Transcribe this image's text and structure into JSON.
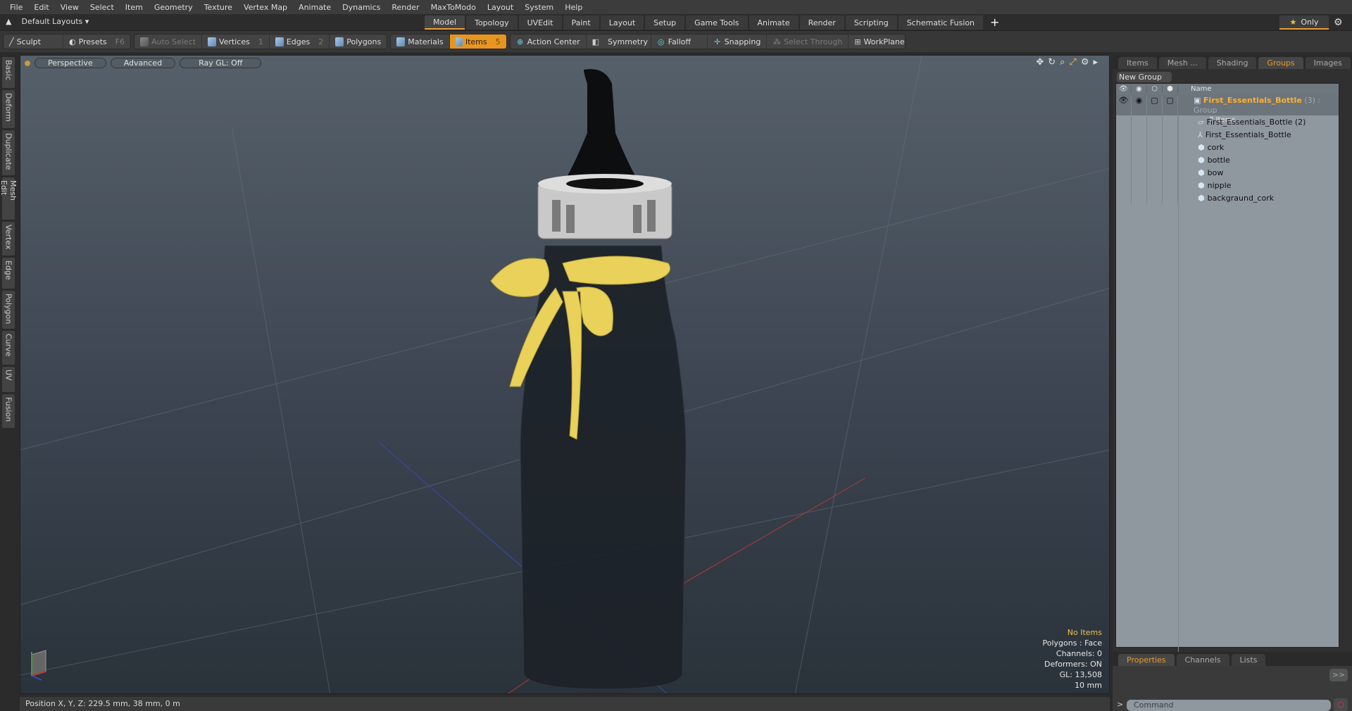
{
  "menu": [
    "File",
    "Edit",
    "View",
    "Select",
    "Item",
    "Geometry",
    "Texture",
    "Vertex Map",
    "Animate",
    "Dynamics",
    "Render",
    "MaxToModo",
    "Layout",
    "System",
    "Help"
  ],
  "layout_selector": {
    "label": "Default Layouts"
  },
  "layout_tabs": [
    {
      "label": "Model",
      "active": true
    },
    {
      "label": "Topology"
    },
    {
      "label": "UVEdit"
    },
    {
      "label": "Paint"
    },
    {
      "label": "Layout"
    },
    {
      "label": "Setup"
    },
    {
      "label": "Game Tools"
    },
    {
      "label": "Animate"
    },
    {
      "label": "Render"
    },
    {
      "label": "Scripting"
    },
    {
      "label": "Schematic Fusion"
    }
  ],
  "only_button": {
    "label": "Only"
  },
  "toolbar": {
    "sculpt": "Sculpt",
    "presets": "Presets",
    "presets_key": "F6",
    "auto_select": "Auto Select",
    "vertices": "Vertices",
    "vertices_key": "1",
    "edges": "Edges",
    "edges_key": "2",
    "polygons": "Polygons",
    "materials": "Materials",
    "items": "Items",
    "items_key": "5",
    "action_center": "Action Center",
    "symmetry": "Symmetry",
    "falloff": "Falloff",
    "snapping": "Snapping",
    "select_through": "Select Through",
    "workplane": "WorkPlane"
  },
  "side_tabs": [
    "Basic",
    "Deform",
    "Duplicate",
    "Mesh Edit",
    "Vertex",
    "Edge",
    "Polygon",
    "Curve",
    "UV",
    "Fusion"
  ],
  "viewport": {
    "view_mode": "Perspective",
    "shading": "Advanced",
    "raygl": "Ray GL: Off",
    "info": {
      "selection": "No Items",
      "polygons": "Polygons : Face",
      "channels": "Channels: 0",
      "deformers": "Deformers: ON",
      "gl": "GL: 13,508",
      "grid": "10 mm"
    }
  },
  "right_panel": {
    "tabs": [
      {
        "label": "Items"
      },
      {
        "label": "Mesh ..."
      },
      {
        "label": "Shading"
      },
      {
        "label": "Groups",
        "active": true
      },
      {
        "label": "Images"
      }
    ],
    "new_group": "New Group",
    "name_header": "Name",
    "group": {
      "name": "First_Essentials_Bottle",
      "count": "(3)",
      "type": ": Group",
      "sub": "7 Items"
    },
    "items": [
      {
        "name": "First_Essentials_Bottle (2)",
        "icon": "folder-icon"
      },
      {
        "name": "First_Essentials_Bottle",
        "icon": "locator-icon"
      },
      {
        "name": "cork",
        "icon": "mesh-icon"
      },
      {
        "name": "bottle",
        "icon": "mesh-icon"
      },
      {
        "name": "bow",
        "icon": "mesh-icon"
      },
      {
        "name": "nipple",
        "icon": "mesh-icon"
      },
      {
        "name": "backgraund_cork",
        "icon": "mesh-icon"
      }
    ],
    "bottom_tabs": [
      {
        "label": "Properties",
        "active": true
      },
      {
        "label": "Channels"
      },
      {
        "label": "Lists"
      }
    ],
    "command_placeholder": "Command"
  },
  "status": {
    "position": "Position X, Y, Z:   229.5 mm, 38 mm, 0 m"
  }
}
